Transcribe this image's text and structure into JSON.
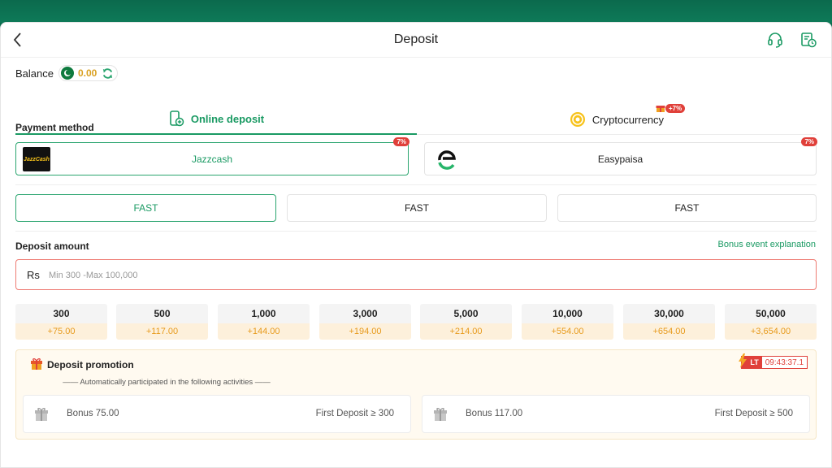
{
  "header": {
    "title": "Deposit"
  },
  "balance": {
    "label": "Balance",
    "value": "0.00"
  },
  "tabs": [
    {
      "label": "Online deposit",
      "active": true
    },
    {
      "label": "Cryptocurrency",
      "active": false,
      "badge": "+7%"
    }
  ],
  "payment_method": {
    "label": "Payment method",
    "options": [
      {
        "name": "Jazzcash",
        "badge": "7%",
        "logo_text": "JazzCash",
        "active": true
      },
      {
        "name": "Easypaisa",
        "badge": "7%",
        "active": false
      }
    ]
  },
  "channels": [
    {
      "label": "FAST",
      "active": true
    },
    {
      "label": "FAST",
      "active": false
    },
    {
      "label": "FAST",
      "active": false
    }
  ],
  "deposit_amount": {
    "label": "Deposit amount",
    "bonus_link": "Bonus event explanation",
    "currency": "Rs",
    "placeholder": "Min 300 -Max 100,000",
    "value": ""
  },
  "chips": [
    {
      "amount": "300",
      "bonus": "+75.00"
    },
    {
      "amount": "500",
      "bonus": "+117.00"
    },
    {
      "amount": "1,000",
      "bonus": "+144.00"
    },
    {
      "amount": "3,000",
      "bonus": "+194.00"
    },
    {
      "amount": "5,000",
      "bonus": "+214.00"
    },
    {
      "amount": "10,000",
      "bonus": "+554.00"
    },
    {
      "amount": "30,000",
      "bonus": "+654.00"
    },
    {
      "amount": "50,000",
      "bonus": "+3,654.00"
    }
  ],
  "promotion": {
    "title": "Deposit promotion",
    "timer_tag": "LT",
    "timer": "09:43:37.1",
    "subtitle": "—— Automatically participated in the following activities ——",
    "items": [
      {
        "bonus": "Bonus 75.00",
        "condition": "First Deposit ≥ 300"
      },
      {
        "bonus": "Bonus 117.00",
        "condition": "First Deposit ≥ 500"
      }
    ]
  },
  "colors": {
    "accent": "#1a9a63",
    "brand_band": "#0b6a4d",
    "badge_red": "#e0403a",
    "bonus_orange": "#e79a1c",
    "balance_gold": "#d9a020"
  }
}
